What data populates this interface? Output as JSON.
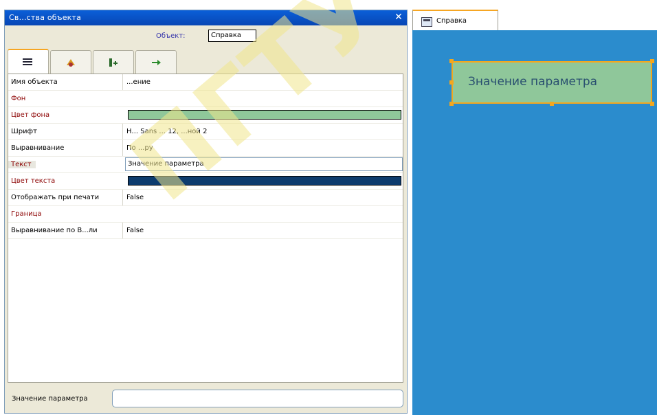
{
  "properties_panel": {
    "title": "Св...ства объекта",
    "object_prefix": "Объект:",
    "object_selected": "Справка",
    "tabs": [
      {
        "icon": "list-icon"
      },
      {
        "icon": "format-icon"
      },
      {
        "icon": "data-icon"
      },
      {
        "icon": "events-icon"
      }
    ],
    "rows": [
      {
        "name": "Имя объекта",
        "value": "...ение"
      },
      {
        "name": "Фон",
        "value": ""
      },
      {
        "name": "Цвет фона",
        "value": ""
      },
      {
        "name": "Шрифт",
        "value": "Н... Sans ... 12, ...ной 2"
      },
      {
        "name": "Выравнивание",
        "value": "По ...ру"
      },
      {
        "name": "Текст",
        "value": "Значение параметра"
      },
      {
        "name": "Цвет текста",
        "value": ""
      },
      {
        "name": "Отображать при печати",
        "value": "False"
      },
      {
        "name": "Граница",
        "value": ""
      },
      {
        "name": "Выравнивание по В...ли",
        "value": "False"
      }
    ],
    "bottom_label": "Значение параметра",
    "bottom_value": ""
  },
  "colors": {
    "fill_swatch": "#8fc79a",
    "text_swatch": "#0d3c6e",
    "canvas": "#2b8ccd"
  },
  "form": {
    "tab_label": "Справка",
    "label_text": "Значение параметра"
  }
}
